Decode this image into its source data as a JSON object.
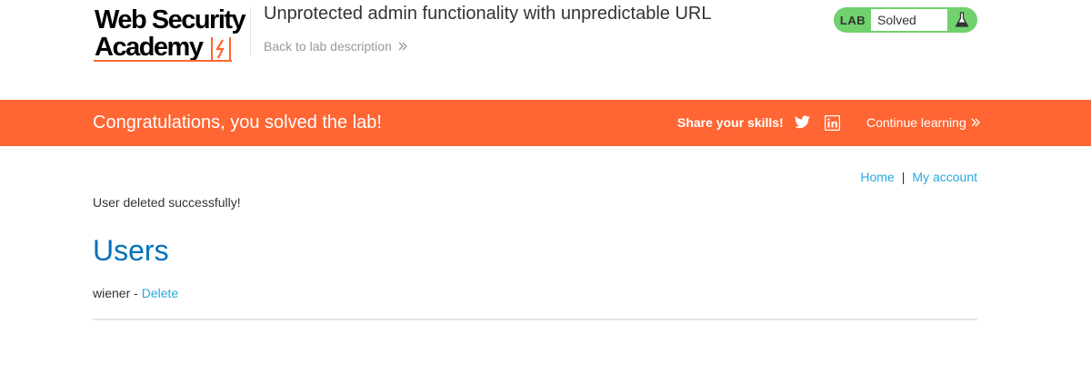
{
  "header": {
    "logo_line1": "Web Security",
    "logo_line2": "Academy",
    "lab_title": "Unprotected admin functionality with unpredictable URL",
    "back_link": "Back to lab description",
    "lab_badge": "LAB",
    "lab_status": "Solved"
  },
  "banner": {
    "message": "Congratulations, you solved the lab!",
    "share": "Share your skills!",
    "continue": "Continue learning",
    "background": "#ff6633"
  },
  "nav": {
    "home": "Home",
    "separator": "|",
    "account": "My account"
  },
  "main": {
    "notice": "User deleted successfully!",
    "heading": "Users",
    "users": [
      {
        "name": "wiener",
        "separator": " - ",
        "action": "Delete"
      }
    ]
  },
  "colors": {
    "accent": "#ff6633",
    "link": "#29a8dc",
    "heading": "#0071bc",
    "solved": "#70d16d"
  }
}
